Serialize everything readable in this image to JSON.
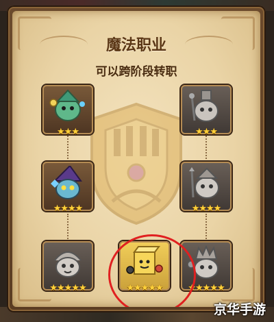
{
  "panel": {
    "title": "魔法职业",
    "subtitle": "可以跨阶段转职"
  },
  "jobs": [
    {
      "name": "left-tier-1",
      "stars": "★★★",
      "state": "unlocked"
    },
    {
      "name": "right-tier-1",
      "stars": "★★★",
      "state": "locked"
    },
    {
      "name": "left-tier-2",
      "stars": "★★★★",
      "state": "unlocked"
    },
    {
      "name": "right-tier-2",
      "stars": "★★★★",
      "state": "locked"
    },
    {
      "name": "left-tier-3",
      "stars": "★★★★★",
      "state": "locked"
    },
    {
      "name": "middle-tier-3",
      "stars": "★★★★★",
      "state": "selected"
    },
    {
      "name": "right-tier-3",
      "stars": "★★★★★",
      "state": "locked"
    }
  ],
  "watermark": "京华手游",
  "colors": {
    "parchment": "#ead4a6",
    "title": "#5b3716",
    "star": "#ffd23a",
    "highlight_ring": "#e02020"
  }
}
